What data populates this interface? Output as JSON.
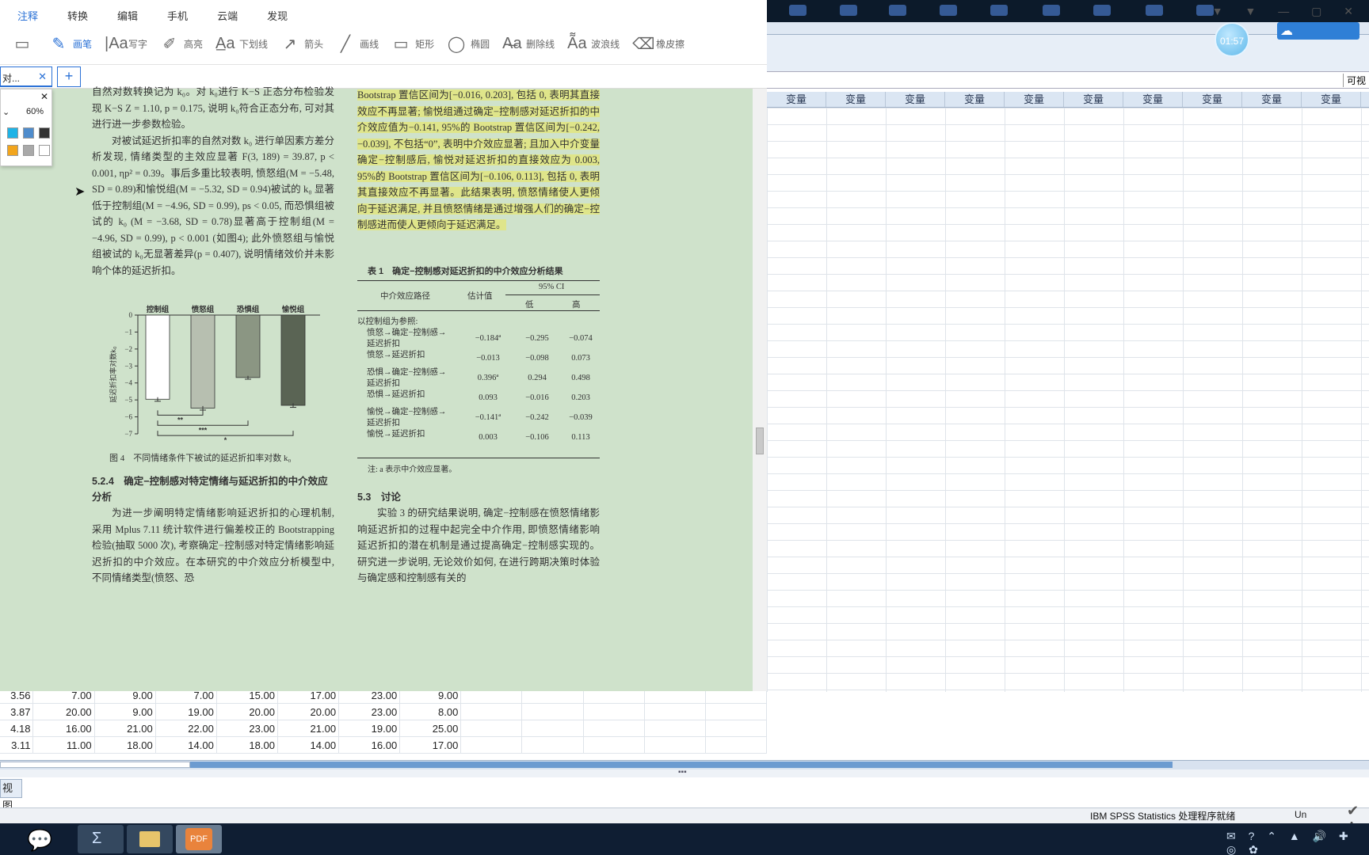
{
  "pdf": {
    "menus": [
      "注释",
      "转换",
      "编辑",
      "手机",
      "云端",
      "发现"
    ],
    "tools": [
      {
        "icon": "pen-icon",
        "label": "画笔"
      },
      {
        "icon": "text-icon",
        "label": "写字"
      },
      {
        "icon": "highlight-icon",
        "label": "高亮"
      },
      {
        "icon": "underline-icon",
        "label": "下划线"
      },
      {
        "icon": "arrow-icon",
        "label": "箭头"
      },
      {
        "icon": "line-icon",
        "label": "画线"
      },
      {
        "icon": "rect-icon",
        "label": "矩形"
      },
      {
        "icon": "ellipse-icon",
        "label": "椭圆"
      },
      {
        "icon": "strike-icon",
        "label": "删除线"
      },
      {
        "icon": "wave-icon",
        "label": "波浪线"
      },
      {
        "icon": "eraser-icon",
        "label": "橡皮擦"
      }
    ],
    "tab_label": "对...",
    "pen_popup": {
      "percent": "60%",
      "colors": [
        "#1fb3e6",
        "#4f8ccc",
        "#333333",
        "#f2a51d",
        "#a9a9a9",
        "#ffffff"
      ]
    },
    "left_col": [
      "自然对数转换记为 k₀。对 k₀进行 K−S 正态分布检验发现 K−S Z = 1.10, p = 0.175, 说明 k₀符合正态分布, 可对其进行进一步参数检验。",
      "对被试延迟折扣率的自然对数 k₀ 进行单因素方差分析发现, 情绪类型的主效应显著 F(3, 189) = 39.87, p < 0.001, ηp² = 0.39。事后多重比较表明, 愤怒组(M = −5.48, SD = 0.89)和愉悦组(M = −5.32, SD = 0.94)被试的 k₀ 显著低于控制组(M = −4.96, SD = 0.99), ps < 0.05, 而恐惧组被试的 k₀ (M = −3.68, SD = 0.78)显著高于控制组(M = −4.96, SD = 0.99), p < 0.001 (如图4); 此外愤怒组与愉悦组被试的 k₀无显著差异(p = 0.407), 说明情绪效价并未影响个体的延迟折扣。"
    ],
    "fig_caption": "图 4　不同情绪条件下被试的延迟折扣率对数 k₀",
    "sec524_title": "5.2.4　确定−控制感对特定情绪与延迟折扣的中介效应分析",
    "sec524_text": "为进一步阐明特定情绪影响延迟折扣的心理机制, 采用 Mplus 7.11 统计软件进行偏差校正的 Bootstrapping 检验(抽取 5000 次), 考察确定−控制感对特定情绪影响延迟折扣的中介效应。在本研究的中介效应分析模型中, 不同情绪类型(愤怒、恐",
    "right_highlight": "Bootstrap 置信区间为[−0.016, 0.203], 包括 0, 表明其直接效应不再显著; 愉悦组通过确定−控制感对延迟折扣的中介效应值为−0.141, 95%的 Bootstrap 置信区间为[−0.242, −0.039], 不包括“0”, 表明中介效应显著; 且加入中介变量确定−控制感后, 愉悦对延迟折扣的直接效应为 0.003, 95%的 Bootstrap 置信区间为[−0.106, 0.113], 包括 0, 表明其直接效应不再显著。此结果表明, 愤怒情绪使人更倾向于延迟满足, 并且愤怒情绪是通过增强人们的确定−控制感进而使人更倾向于延迟满足。",
    "table_title": "表 1　确定−控制感对延迟折扣的中介效应分析结果",
    "table_head": {
      "path": "中介效应路径",
      "est": "估计值",
      "ci": "95% CI",
      "low": "低",
      "high": "高"
    },
    "table_ref": "以控制组为参照:",
    "table_rows": [
      [
        "愤怒→确定−控制感→\n延迟折扣",
        "−0.184ª",
        "−0.295",
        "−0.074"
      ],
      [
        "愤怒→延迟折扣",
        "−0.013",
        "−0.098",
        "0.073"
      ],
      [
        "恐惧→确定−控制感→\n延迟折扣",
        "0.396ª",
        "0.294",
        "0.498"
      ],
      [
        "恐惧→延迟折扣",
        "0.093",
        "−0.016",
        "0.203"
      ],
      [
        "愉悦→确定−控制感→\n延迟折扣",
        "−0.141ª",
        "−0.242",
        "−0.039"
      ],
      [
        "愉悦→延迟折扣",
        "0.003",
        "−0.106",
        "0.113"
      ]
    ],
    "table_note": "注: a 表示中介效应显著。",
    "sec53_title": "5.3　讨论",
    "sec53_text": "实验 3 的研究结果说明, 确定−控制感在愤怒情绪影响延迟折扣的过程中起完全中介作用, 即愤怒情绪影响延迟折扣的潜在机制是通过提高确定−控制感实现的。研究进一步说明, 无论效价如何, 在进行跨期决策时体验与确定感和控制感有关的"
  },
  "chart_data": {
    "type": "bar",
    "categories": [
      "控制组",
      "愤怒组",
      "恐惧组",
      "愉悦组"
    ],
    "values": [
      -4.96,
      -5.48,
      -3.68,
      -5.32
    ],
    "errors": [
      0.12,
      0.12,
      0.1,
      0.12
    ],
    "ylabel": "延迟折扣率对数k₀",
    "ylim": [
      -7,
      0
    ],
    "yticks": [
      "0",
      "−1",
      "−2",
      "−3",
      "−4",
      "−5",
      "−6",
      "−7"
    ],
    "colors": [
      "#ffffff",
      "#b7bfb0",
      "#8b9683",
      "#5a6454"
    ],
    "significance": [
      "**",
      "***",
      "*"
    ]
  },
  "spss": {
    "col_header": "变量",
    "cellbar_label": "可视",
    "rows": [
      [
        "3.56",
        "7.00",
        "9.00",
        "7.00",
        "15.00",
        "17.00",
        "23.00",
        "9.00"
      ],
      [
        "3.87",
        "20.00",
        "9.00",
        "19.00",
        "20.00",
        "20.00",
        "23.00",
        "8.00"
      ],
      [
        "4.18",
        "16.00",
        "21.00",
        "22.00",
        "23.00",
        "21.00",
        "19.00",
        "25.00"
      ],
      [
        "3.11",
        "11.00",
        "18.00",
        "14.00",
        "18.00",
        "14.00",
        "16.00",
        "17.00"
      ]
    ],
    "view_tab": "视图",
    "status": "IBM SPSS Statistics 处理程序就绪",
    "unicode": "Un",
    "timer": "01:57"
  }
}
